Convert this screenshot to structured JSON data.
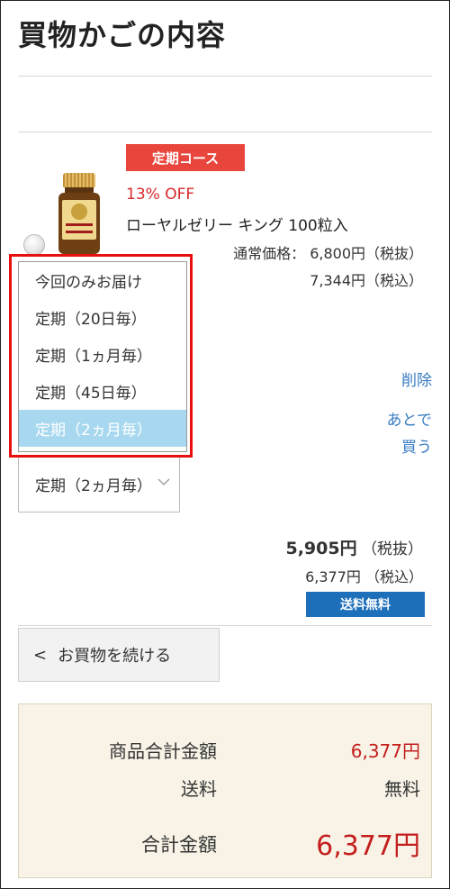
{
  "page": {
    "title": "買物かごの内容"
  },
  "item": {
    "course_badge": "定期コース",
    "discount": "13% OFF",
    "name": "ローヤルゼリー キング 100粒入",
    "regular_price_label": "通常価格：",
    "regular_price_ex": "6,800円（税抜）",
    "regular_price_in": "7,344円（税込）",
    "delete_label": "削除",
    "later_line1": "あとで",
    "later_line2": "買う",
    "subtotal_ex_value": "5,905円",
    "subtotal_ex_suffix": "（税抜）",
    "subtotal_in": "6,377円 （税込）",
    "shipping_badge": "送料無料"
  },
  "delivery_select": {
    "selected_value": "定期（2ヵ月毎）",
    "options": [
      "今回のみお届け",
      "定期（20日毎）",
      "定期（1ヵ月毎）",
      "定期（45日毎）",
      "定期（2ヵ月毎）"
    ],
    "selected_index": 4
  },
  "continue_button": {
    "label": "お買物を続ける"
  },
  "summary": {
    "product_total_label": "商品合計金額",
    "product_total_value": "6,377円",
    "shipping_label": "送料",
    "shipping_value": "無料",
    "grand_total_label": "合計金額",
    "grand_total_value": "6,377円"
  },
  "colors": {
    "course_badge": "#e8453c",
    "discount": "#d8282a",
    "link": "#3a7cc3",
    "shipping_badge": "#1d6fba",
    "selected_option": "#a7d8f0",
    "highlight_box": "#e8100f",
    "summary_bg": "#f8f3e6",
    "total_price": "#c41e1e"
  }
}
